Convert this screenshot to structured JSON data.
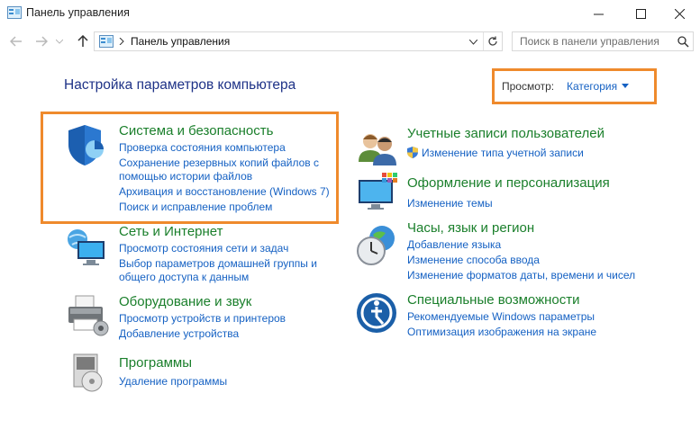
{
  "window": {
    "title": "Панель управления"
  },
  "address": {
    "crumb": "Панель управления"
  },
  "search": {
    "placeholder": "Поиск в панели управления"
  },
  "header": {
    "title": "Настройка параметров компьютера",
    "view_label": "Просмотр:",
    "view_value": "Категория"
  },
  "categories": {
    "system": {
      "title": "Система и безопасность",
      "links": [
        "Проверка состояния компьютера",
        "Сохранение резервных копий файлов с",
        "помощью истории файлов",
        "Архивация и восстановление (Windows 7)",
        "Поиск и исправление проблем"
      ]
    },
    "network": {
      "title": "Сеть и Интернет",
      "links": [
        "Просмотр состояния сети и задач",
        "Выбор параметров домашней группы и",
        "общего доступа к данным"
      ]
    },
    "hardware": {
      "title": "Оборудование и звук",
      "links": [
        "Просмотр устройств и принтеров",
        "Добавление устройства"
      ]
    },
    "programs": {
      "title": "Программы",
      "links": [
        "Удаление программы"
      ]
    },
    "accounts": {
      "title": "Учетные записи пользователей",
      "links": [
        "Изменение типа учетной записи"
      ]
    },
    "appearance": {
      "title": "Оформление и персонализация",
      "links": [
        "Изменение темы"
      ]
    },
    "clock": {
      "title": "Часы, язык и регион",
      "links": [
        "Добавление языка",
        "Изменение способа ввода",
        "Изменение форматов даты, времени и чисел"
      ]
    },
    "ease": {
      "title": "Специальные возможности",
      "links": [
        "Рекомендуемые Windows параметры",
        "Оптимизация изображения на экране"
      ]
    }
  },
  "colors": {
    "highlight": "#ef8a2c",
    "link": "#1561c3",
    "category_title": "#1a7f2b",
    "heading": "#1e3287"
  }
}
